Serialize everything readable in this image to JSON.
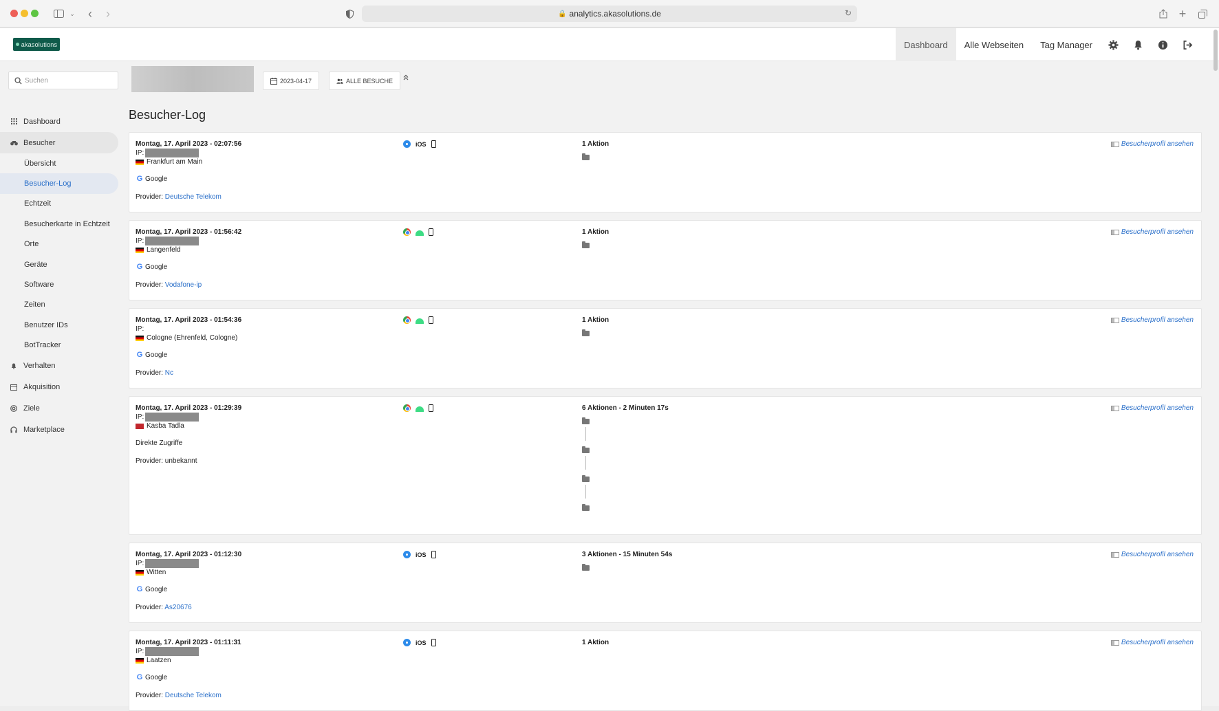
{
  "browser": {
    "url": "analytics.akasolutions.de"
  },
  "app": {
    "logo_text": "akasolutions",
    "nav": {
      "dashboard": "Dashboard",
      "all_sites": "Alle Webseiten",
      "tag_manager": "Tag Manager"
    },
    "icons": [
      "gear-icon",
      "bell-icon",
      "info-icon",
      "logout-icon"
    ]
  },
  "sidebar": {
    "search_placeholder": "Suchen",
    "items": [
      {
        "label": "Dashboard",
        "icon": "grid-icon"
      },
      {
        "label": "Besucher",
        "icon": "binoculars-icon",
        "open": true
      },
      {
        "label": "Verhalten",
        "icon": "bell-icon"
      },
      {
        "label": "Akquisition",
        "icon": "box-icon"
      },
      {
        "label": "Ziele",
        "icon": "target-icon"
      },
      {
        "label": "Marketplace",
        "icon": "headphones-icon"
      }
    ],
    "sub_items": [
      "Übersicht",
      "Besucher-Log",
      "Echtzeit",
      "Besucherkarte in Echtzeit",
      "Orte",
      "Geräte",
      "Software",
      "Zeiten",
      "Benutzer IDs",
      "BotTracker"
    ],
    "active_sub": "Besucher-Log"
  },
  "filters": {
    "date": "2023-04-17",
    "segment": "ALLE BESUCHE"
  },
  "page_title": "Besucher-Log",
  "visits": [
    {
      "datetime": "Montag, 17. April 2023 - 02:07:56",
      "ip_label": "IP:",
      "location": "Frankfurt am Main",
      "flag": "de",
      "source": "Google",
      "provider_label": "Provider:",
      "provider": "Deutsche Telekom",
      "provider_link": true,
      "browser": "safari",
      "os": "iOS",
      "device": "smartphone",
      "actions": "1 Aktion",
      "action_count": 1,
      "profile_link": "Besucherprofil ansehen"
    },
    {
      "datetime": "Montag, 17. April 2023 - 01:56:42",
      "ip_label": "IP:",
      "location": "Langenfeld",
      "flag": "de",
      "source": "Google",
      "provider_label": "Provider:",
      "provider": "Vodafone-ip",
      "provider_link": true,
      "browser": "chrome",
      "os": "android",
      "device": "smartphone",
      "actions": "1 Aktion",
      "action_count": 1,
      "profile_link": "Besucherprofil ansehen"
    },
    {
      "datetime": "Montag, 17. April 2023 - 01:54:36",
      "ip_label": "IP:",
      "location": "Cologne (Ehrenfeld, Cologne)",
      "flag": "de",
      "source": "Google",
      "provider_label": "Provider:",
      "provider": "Nc",
      "provider_link": true,
      "browser": "chrome",
      "os": "android",
      "device": "smartphone",
      "actions": "1 Aktion",
      "action_count": 1,
      "profile_link": "Besucherprofil ansehen",
      "ip_masked": false
    },
    {
      "datetime": "Montag, 17. April 2023 - 01:29:39",
      "ip_label": "IP:",
      "location": "Kasba Tadla",
      "flag": "ma",
      "source": "Direkte Zugriffe",
      "provider_label": "Provider:",
      "provider": "unbekannt",
      "provider_link": false,
      "browser": "chrome",
      "os": "android",
      "device": "smartphone",
      "actions": "6 Aktionen - 2 Minuten 17s",
      "action_count": 4,
      "profile_link": "Besucherprofil ansehen"
    },
    {
      "datetime": "Montag, 17. April 2023 - 01:12:30",
      "ip_label": "IP:",
      "location": "Witten",
      "flag": "de",
      "source": "Google",
      "provider_label": "Provider:",
      "provider": "As20676",
      "provider_link": true,
      "browser": "safari",
      "os": "iOS",
      "device": "smartphone",
      "actions": "3 Aktionen - 15 Minuten 54s",
      "action_count": 1,
      "profile_link": "Besucherprofil ansehen"
    },
    {
      "datetime": "Montag, 17. April 2023 - 01:11:31",
      "ip_label": "IP:",
      "location": "Laatzen",
      "flag": "de",
      "source": "Google",
      "provider_label": "Provider:",
      "provider": "Deutsche Telekom",
      "provider_link": true,
      "browser": "safari",
      "os": "iOS",
      "device": "smartphone",
      "actions": "1 Aktion",
      "action_count": 0,
      "profile_link": "Besucherprofil ansehen"
    }
  ]
}
